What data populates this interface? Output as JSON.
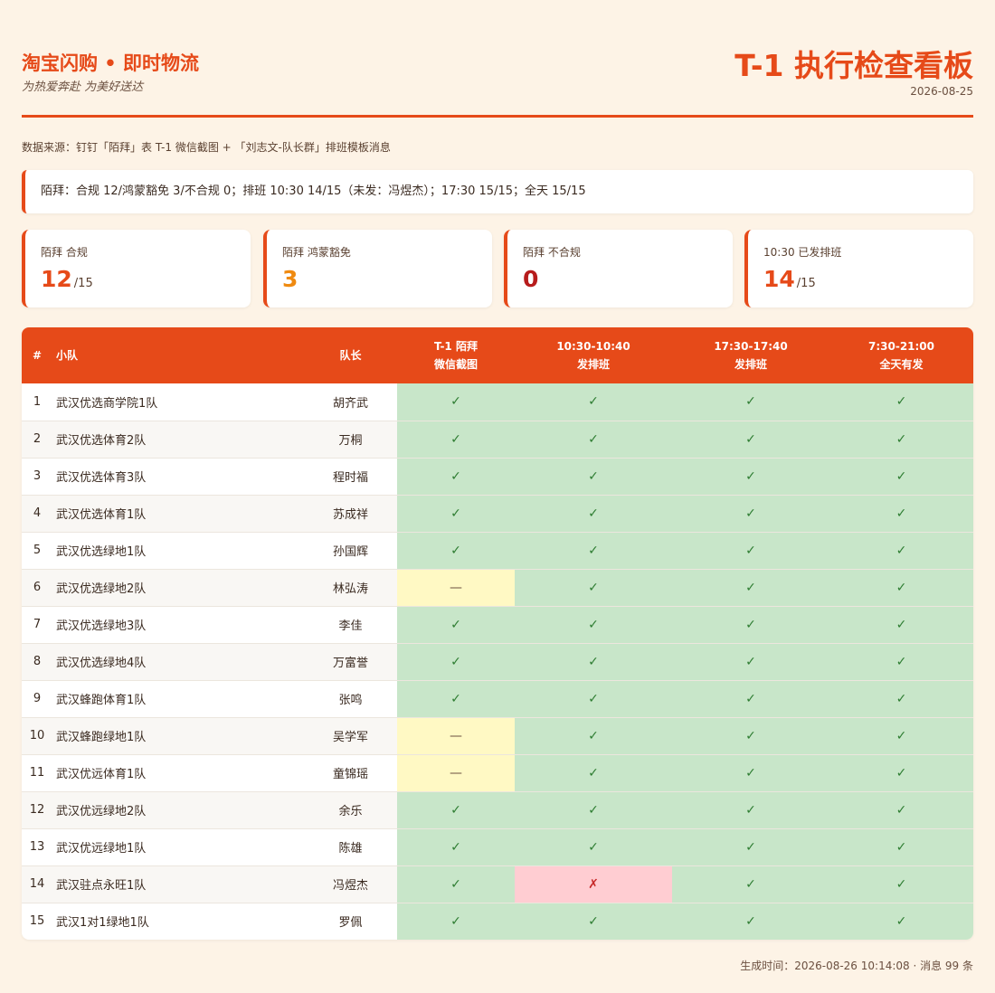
{
  "header": {
    "brand": "淘宝闪购 • 即时物流",
    "slogan": "为热爱奔赴 为美好送达",
    "title": "T-1 执行检查看板",
    "date": "2026-08-25"
  },
  "source": "数据来源：钉钉「陌拜」表 T-1 微信截图 + 「刘志文-队长群」排班模板消息",
  "summary": "陌拜：合规 12/鸿蒙豁免 3/不合规 0；排班 10:30 14/15（未发：冯煜杰）；17:30 15/15；全天 15/15",
  "cards": [
    {
      "label": "陌拜 合规",
      "value": "12",
      "denominator": "/15",
      "color": "#e64a19"
    },
    {
      "label": "陌拜 鸿蒙豁免",
      "value": "3",
      "denominator": "",
      "color": "#ef8a10"
    },
    {
      "label": "陌拜 不合规",
      "value": "0",
      "denominator": "",
      "color": "#b71c1c"
    },
    {
      "label": "10:30 已发排班",
      "value": "14",
      "denominator": "/15",
      "color": "#e64a19"
    }
  ],
  "table": {
    "headers": {
      "num": "#",
      "squad": "小队",
      "leader": "队长",
      "c1_line1": "T-1 陌拜",
      "c1_line2": "微信截图",
      "c2_line1": "10:30-10:40",
      "c2_line2": "发排班",
      "c3_line1": "17:30-17:40",
      "c3_line2": "发排班",
      "c4_line1": "7:30-21:00",
      "c4_line2": "全天有发"
    },
    "symbols": {
      "ok": "✓",
      "na": "—",
      "bad": "✗"
    },
    "rows": [
      {
        "num": "1",
        "squad": "武汉优选商学院1队",
        "leader": "胡齐武",
        "status": [
          "ok",
          "ok",
          "ok",
          "ok"
        ]
      },
      {
        "num": "2",
        "squad": "武汉优选体育2队",
        "leader": "万桐",
        "status": [
          "ok",
          "ok",
          "ok",
          "ok"
        ]
      },
      {
        "num": "3",
        "squad": "武汉优选体育3队",
        "leader": "程时福",
        "status": [
          "ok",
          "ok",
          "ok",
          "ok"
        ]
      },
      {
        "num": "4",
        "squad": "武汉优选体育1队",
        "leader": "苏成祥",
        "status": [
          "ok",
          "ok",
          "ok",
          "ok"
        ]
      },
      {
        "num": "5",
        "squad": "武汉优选绿地1队",
        "leader": "孙国辉",
        "status": [
          "ok",
          "ok",
          "ok",
          "ok"
        ]
      },
      {
        "num": "6",
        "squad": "武汉优选绿地2队",
        "leader": "林弘涛",
        "status": [
          "na",
          "ok",
          "ok",
          "ok"
        ]
      },
      {
        "num": "7",
        "squad": "武汉优选绿地3队",
        "leader": "李佳",
        "status": [
          "ok",
          "ok",
          "ok",
          "ok"
        ]
      },
      {
        "num": "8",
        "squad": "武汉优选绿地4队",
        "leader": "万富誉",
        "status": [
          "ok",
          "ok",
          "ok",
          "ok"
        ]
      },
      {
        "num": "9",
        "squad": "武汉蜂跑体育1队",
        "leader": "张鸣",
        "status": [
          "ok",
          "ok",
          "ok",
          "ok"
        ]
      },
      {
        "num": "10",
        "squad": "武汉蜂跑绿地1队",
        "leader": "吴学军",
        "status": [
          "na",
          "ok",
          "ok",
          "ok"
        ]
      },
      {
        "num": "11",
        "squad": "武汉优远体育1队",
        "leader": "童锦瑶",
        "status": [
          "na",
          "ok",
          "ok",
          "ok"
        ]
      },
      {
        "num": "12",
        "squad": "武汉优远绿地2队",
        "leader": "余乐",
        "status": [
          "ok",
          "ok",
          "ok",
          "ok"
        ]
      },
      {
        "num": "13",
        "squad": "武汉优远绿地1队",
        "leader": "陈雄",
        "status": [
          "ok",
          "ok",
          "ok",
          "ok"
        ]
      },
      {
        "num": "14",
        "squad": "武汉驻点永旺1队",
        "leader": "冯煜杰",
        "status": [
          "ok",
          "bad",
          "ok",
          "ok"
        ]
      },
      {
        "num": "15",
        "squad": "武汉1对1绿地1队",
        "leader": "罗佩",
        "status": [
          "ok",
          "ok",
          "ok",
          "ok"
        ]
      }
    ]
  },
  "footer": "生成时间：2026-08-26 10:14:08 · 消息 99 条"
}
